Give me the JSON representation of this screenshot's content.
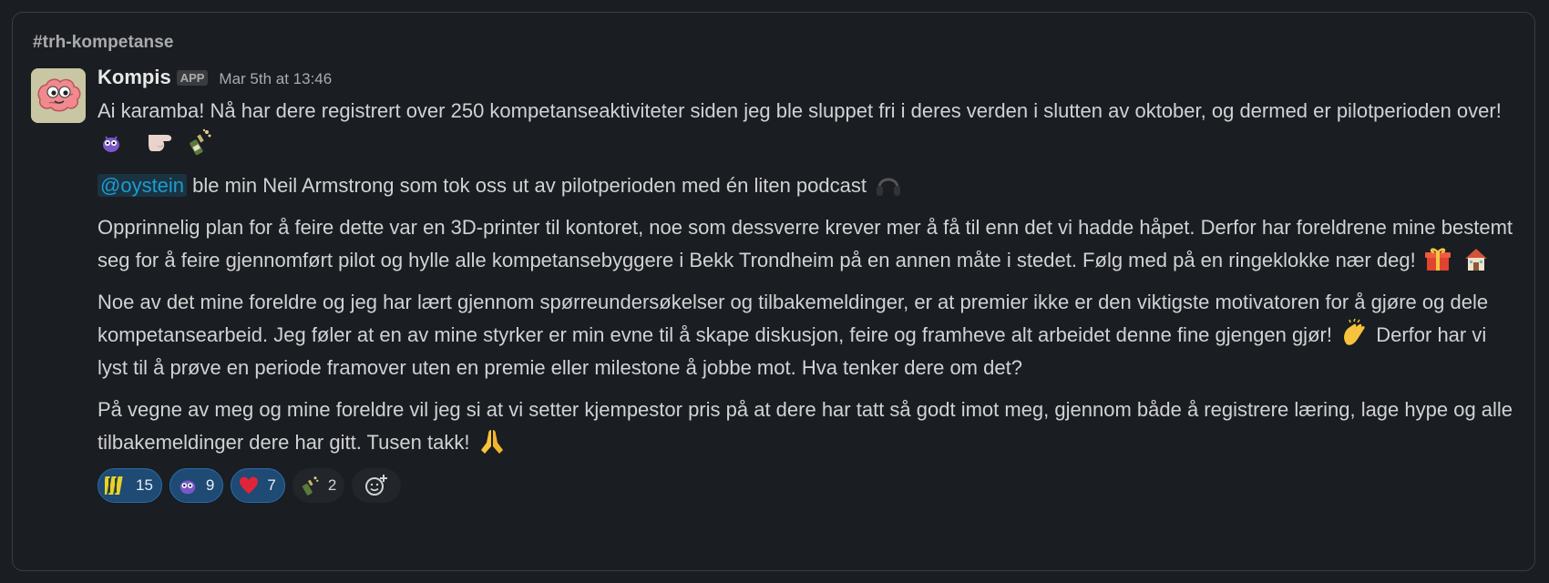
{
  "channel": {
    "name": "#trh-kompetanse"
  },
  "message": {
    "sender": "Kompis",
    "badge": "APP",
    "timestamp": "Mar 5th at 13:46",
    "p1": "Ai karamba! Nå har dere registrert over 250 kompetanseaktiviteter siden jeg ble sluppet fri i deres verden i slutten av oktober, og dermed er pilotperioden over!",
    "p2_mention": "@oystein",
    "p2_text": "ble min Neil Armstrong som tok oss ut av pilotperioden med én liten podcast",
    "p3": "Opprinnelig plan for å feire dette var en 3D-printer til kontoret, noe som dessverre krever mer å få til enn det vi hadde håpet. Derfor har foreldrene mine bestemt seg for å feire gjennomført pilot og hylle alle kompetansebyggere i Bekk Trondheim på en annen måte i stedet. Følg med på en ringeklokke nær deg!",
    "p4_a": "Noe av det mine foreldre og jeg har lært gjennom spørreundersøkelser og tilbakemeldinger, er at premier ikke er den viktigste motivatoren for å gjøre og dele kompetansearbeid. Jeg føler at en av mine styrker er min evne til å skape diskusjon, feire og framheve alt arbeidet denne fine gjengen gjør!",
    "p4_b": "Derfor har vi lyst til å prøve en periode framover uten en premie eller milestone å jobbe mot. Hva tenker dere om det?",
    "p5": "På vegne av meg og mine foreldre vil jeg si at vi setter kjempestor pris på at dere har tatt så godt imot meg, gjennom både å registrere læring, lage hype og alle tilbakemeldinger dere har gitt. Tusen takk!"
  },
  "reactions": [
    {
      "icon": "yellow-stripes-icon",
      "count": "15",
      "active": true
    },
    {
      "icon": "purple-monster-icon",
      "count": "9",
      "active": true
    },
    {
      "icon": "red-heart-icon",
      "count": "7",
      "active": true
    },
    {
      "icon": "champagne-icon",
      "count": "2",
      "active": false
    }
  ],
  "colors": {
    "background": "#1a1d21",
    "text": "#d1d2d3",
    "mention": "#1d9bd1",
    "reaction_active": "#1e4a73",
    "reaction_inactive": "#22252a"
  }
}
